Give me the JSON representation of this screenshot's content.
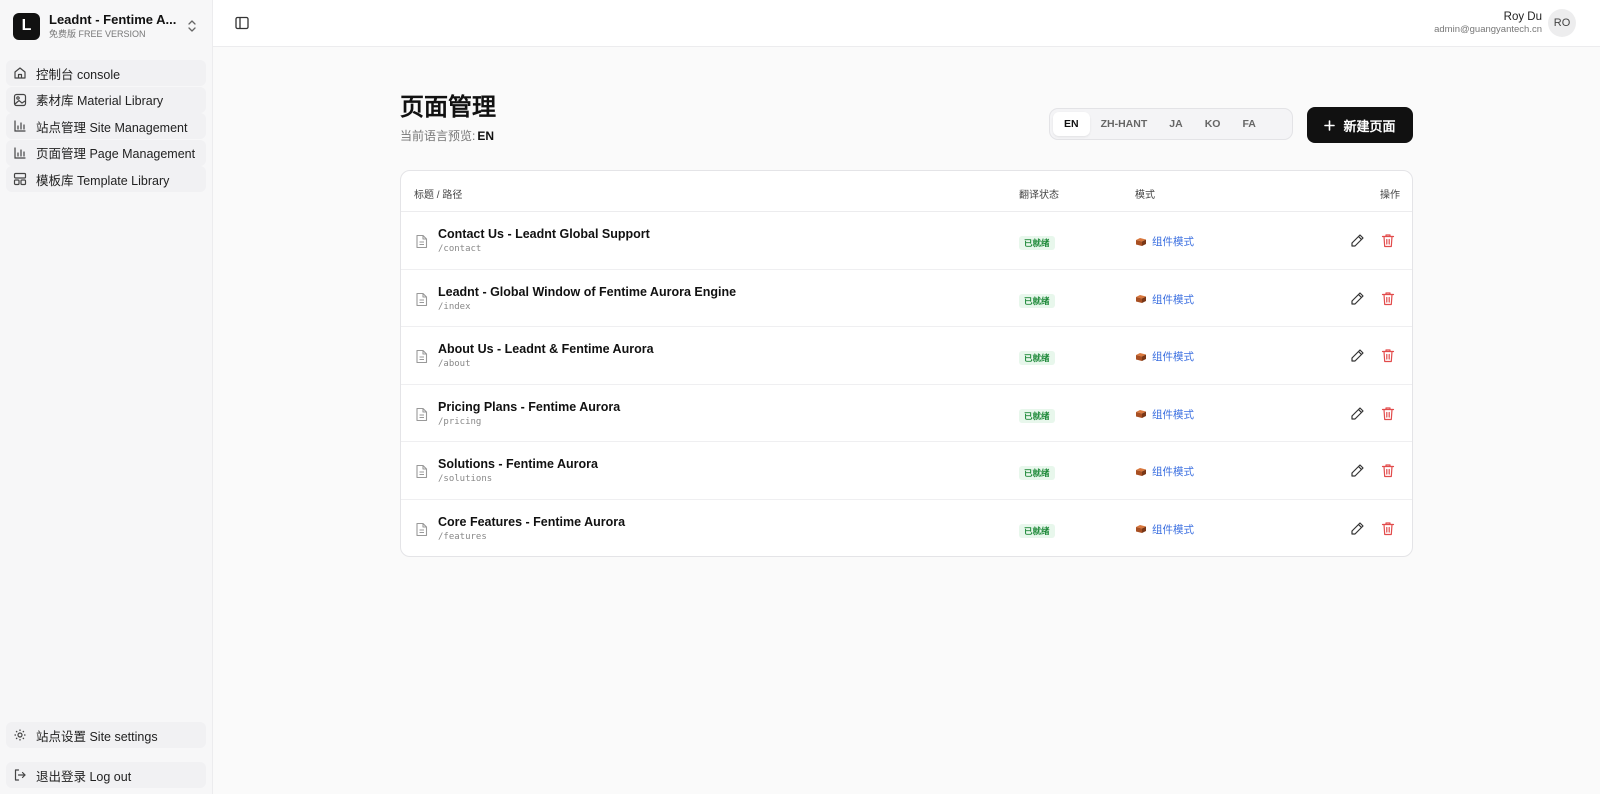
{
  "brand": {
    "logo": "L",
    "name": "Leadnt - Fentime A...",
    "sub": "免费版  FREE VERSION"
  },
  "nav": [
    {
      "label": "控制台  console",
      "icon": "home-icon"
    },
    {
      "label": "素材库  Material Library",
      "icon": "image-icon"
    },
    {
      "label": "站点管理  Site Management",
      "icon": "bar-chart-icon"
    },
    {
      "label": "页面管理  Page Management",
      "icon": "bar-chart-icon"
    },
    {
      "label": "模板库  Template Library",
      "icon": "layout-icon"
    }
  ],
  "bottom": {
    "settings": "站点设置  Site settings",
    "logout": "退出登录  Log out"
  },
  "user": {
    "name": "Roy Du",
    "email": "admin@guangyantech.cn",
    "initials": "RO"
  },
  "page": {
    "title": "页面管理",
    "sub_label": "当前语言预览:",
    "sub_value": "EN"
  },
  "languages": [
    "EN",
    "ZH-HANT",
    "JA",
    "KO",
    "FA"
  ],
  "active_language": "EN",
  "new_button": "新建页面",
  "table": {
    "headers": {
      "title_path": "标题 / 路径",
      "status": "翻译状态",
      "mode": "模式",
      "actions": "操作"
    },
    "rows": [
      {
        "title": "Contact Us - Leadnt Global Support",
        "path": "/contact",
        "status": "已就绪",
        "mode": "组件模式"
      },
      {
        "title": "Leadnt - Global Window of Fentime Aurora Engine",
        "path": "/index",
        "status": "已就绪",
        "mode": "组件模式"
      },
      {
        "title": "About Us - Leadnt & Fentime Aurora",
        "path": "/about",
        "status": "已就绪",
        "mode": "组件模式"
      },
      {
        "title": "Pricing Plans - Fentime Aurora",
        "path": "/pricing",
        "status": "已就绪",
        "mode": "组件模式"
      },
      {
        "title": "Solutions - Fentime Aurora",
        "path": "/solutions",
        "status": "已就绪",
        "mode": "组件模式"
      },
      {
        "title": "Core Features - Fentime Aurora",
        "path": "/features",
        "status": "已就绪",
        "mode": "组件模式"
      }
    ]
  },
  "colors": {
    "accent": "#111111",
    "link": "#3b6fe0",
    "success": "#1f8a3a",
    "danger": "#e24b4b"
  }
}
